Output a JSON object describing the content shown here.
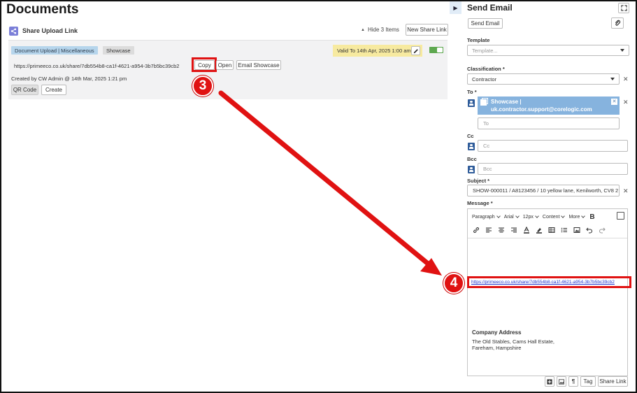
{
  "documents": {
    "title": "Documents",
    "share_section": {
      "icon": "share-icon",
      "title": "Share Upload Link",
      "hide_label": "Hide 3 Items",
      "new_share_label": "New Share Link"
    },
    "share_card": {
      "category_tag": "Document Upload | Miscellaneous",
      "showcase_tag": "Showcase",
      "valid_label": "Valid To 14th Apr, 2025 1:00 am",
      "url": "https://primeeco.co.uk/share/7db554b8-ca1f-4621-a954-3b7b5bc39cb2",
      "copy_label": "Copy",
      "open_label": "Open",
      "email_label": "Email Showcase",
      "created_text": "Created by CW Admin @ 14th Mar, 2025 1:21 pm",
      "qr_label": "QR Code",
      "create_label": "Create"
    }
  },
  "annotations": {
    "step3": "3",
    "step4": "4",
    "highlight_color": "#e01212"
  },
  "email_panel": {
    "title": "Send Email",
    "send_label": "Send Email",
    "template": {
      "label": "Template",
      "placeholder": "Template..."
    },
    "classification": {
      "label": "Classification *",
      "value": "Contractor"
    },
    "to": {
      "label": "To *",
      "chip_line1": "Showcase |",
      "chip_line2": "uk.contractor.support@corelogic.com",
      "placeholder": "To"
    },
    "cc": {
      "label": "Cc",
      "placeholder": "Cc"
    },
    "bcc": {
      "label": "Bcc",
      "placeholder": "Bcc"
    },
    "subject": {
      "label": "Subject *",
      "value": "SHOW-000011 / A8123456 / 10 yellow lane, Kenilworth, CV8 2"
    },
    "message": {
      "label": "Message *",
      "toolbar": {
        "paragraph": "Paragraph",
        "font": "Arial",
        "size": "12px",
        "content": "Content",
        "more": "More",
        "bold": "B"
      },
      "body_link": "https://primeeco.co.uk/share/7db554b8-ca1f-4621-a954-3b7b5bc39cb2",
      "address_title": "Company Address",
      "address_line1": "The Old Stables, Cams Hall Estate,",
      "address_line2": "Fareham, Hampshire"
    },
    "footer": {
      "tag_label": "Tag",
      "share_link_label": "Share Link"
    }
  }
}
